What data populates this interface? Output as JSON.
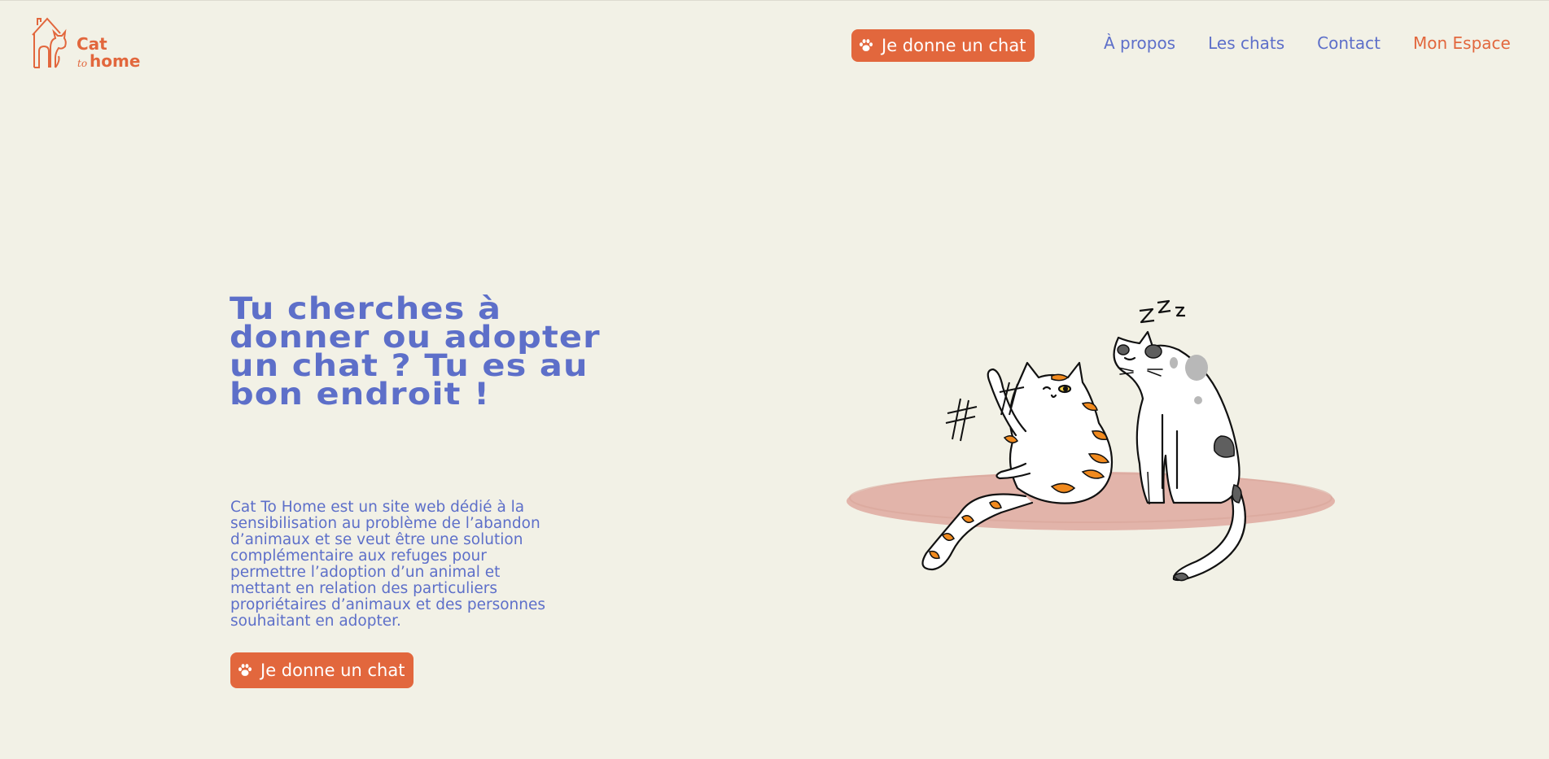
{
  "header": {
    "logo": {
      "line1": "Cat",
      "line2_small": "to",
      "line2": "home"
    },
    "cta_label": "Je donne un chat",
    "nav": [
      {
        "label": "À propos"
      },
      {
        "label": "Les chats"
      },
      {
        "label": "Contact"
      },
      {
        "label": "Mon Espace"
      }
    ]
  },
  "hero": {
    "title": "Tu cherches à donner ou adopter un chat ? Tu es au bon endroit !",
    "description": "Cat To Home est un site web dédié à la sensibilisation au problème de l’abandon d’animaux et se veut être une solution complémentaire aux refuges pour permettre l’adoption d’un animal et mettant en relation des particuliers propriétaires d’animaux et des personnes souhaitant en adopter.",
    "cta_label": "Je donne un chat"
  },
  "icons": {
    "cta": "paw-icon",
    "logo": "house-cat-icon"
  },
  "colors": {
    "background": "#f2f1e6",
    "accent": "#e2673d",
    "primary_text": "#5d6fc9",
    "rug": "#e2b4aa",
    "cat_orange": "#f18a1e"
  }
}
